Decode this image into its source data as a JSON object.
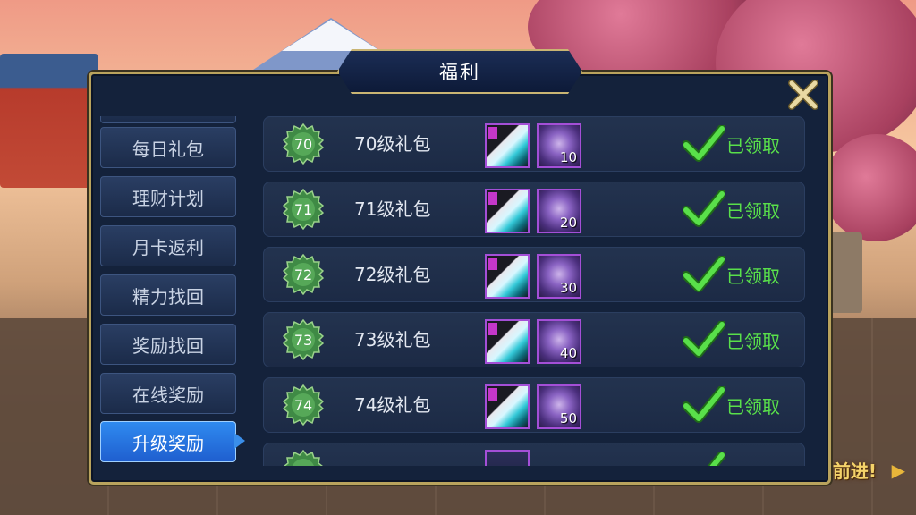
{
  "window": {
    "title": "福利"
  },
  "background": {
    "banner_text": "前进!"
  },
  "sidebar": {
    "items": [
      {
        "label": "每日礼包",
        "active": false
      },
      {
        "label": "理财计划",
        "active": false
      },
      {
        "label": "月卡返利",
        "active": false
      },
      {
        "label": "精力找回",
        "active": false
      },
      {
        "label": "奖励找回",
        "active": false
      },
      {
        "label": "在线奖励",
        "active": false
      },
      {
        "label": "升级奖励",
        "active": true
      }
    ]
  },
  "rewards": [
    {
      "level": "70",
      "name": "70级礼包",
      "crystal_count": "10",
      "status": "已领取"
    },
    {
      "level": "71",
      "name": "71级礼包",
      "crystal_count": "20",
      "status": "已领取"
    },
    {
      "level": "72",
      "name": "72级礼包",
      "crystal_count": "30",
      "status": "已领取"
    },
    {
      "level": "73",
      "name": "73级礼包",
      "crystal_count": "40",
      "status": "已领取"
    },
    {
      "level": "74",
      "name": "74级礼包",
      "crystal_count": "50",
      "status": "已领取"
    }
  ],
  "colors": {
    "accent": "#2f8bf0",
    "claimed": "#59e04a",
    "frame": "#b9a35d",
    "rare_border": "#a44fd7"
  },
  "icons": {
    "close": "close-x-icon",
    "check": "checkmark-icon",
    "level_badge": "level-badge-icon"
  }
}
